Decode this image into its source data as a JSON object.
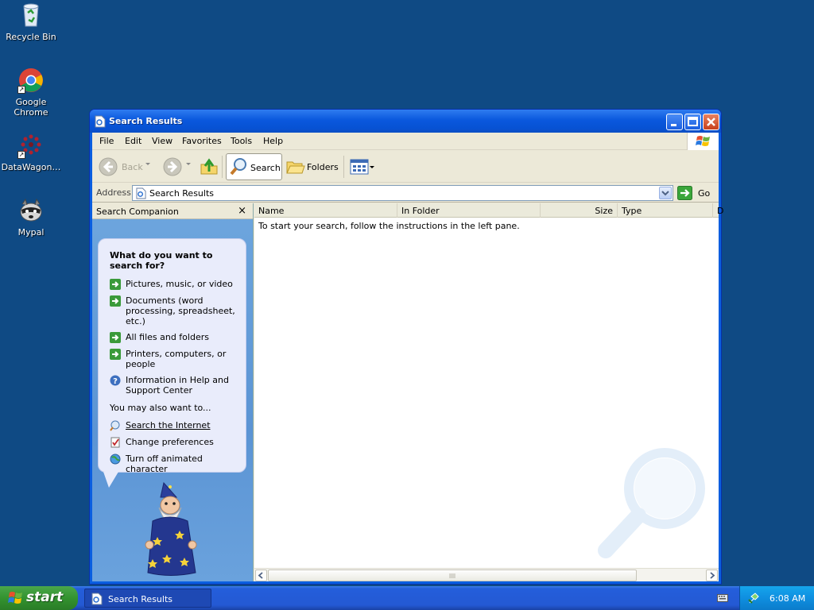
{
  "desktop": {
    "icons": [
      {
        "label": "Recycle Bin",
        "icon": "recycle-bin-icon"
      },
      {
        "label": "Google Chrome",
        "icon": "chrome-icon"
      },
      {
        "label": "DataWagon…",
        "icon": "datawagon-icon"
      },
      {
        "label": "Mypal",
        "icon": "mypal-icon"
      }
    ]
  },
  "window": {
    "title": "Search Results",
    "menu": [
      "File",
      "Edit",
      "View",
      "Favorites",
      "Tools",
      "Help"
    ],
    "toolbar": {
      "back": "Back",
      "search": "Search",
      "folders": "Folders"
    },
    "address": {
      "label": "Address",
      "value": "Search Results",
      "go": "Go"
    },
    "companion": {
      "header": "Search Companion",
      "close": "×",
      "question": "What do you want to search for?",
      "options": [
        {
          "label": "Pictures, music, or video",
          "icon": "green-arrow-icon"
        },
        {
          "label": "Documents (word processing, spreadsheet, etc.)",
          "icon": "green-arrow-icon"
        },
        {
          "label": "All files and folders",
          "icon": "green-arrow-icon"
        },
        {
          "label": "Printers, computers, or people",
          "icon": "green-arrow-icon"
        },
        {
          "label": "Information in Help and Support Center",
          "icon": "help-icon"
        }
      ],
      "also_label": "You may also want to...",
      "also_options": [
        {
          "label": "Search the Internet",
          "icon": "search-internet-icon"
        },
        {
          "label": "Change preferences",
          "icon": "preferences-icon"
        },
        {
          "label": "Turn off animated character",
          "icon": "globe-icon"
        }
      ]
    },
    "results": {
      "columns": [
        "Name",
        "In Folder",
        "Size",
        "Type",
        "D"
      ],
      "message": "To start your search, follow the instructions in the left pane."
    }
  },
  "taskbar": {
    "start": "start",
    "task": "Search Results",
    "clock": "6:08 AM"
  },
  "colors": {
    "desktop": "#0f4a84",
    "titlebar": "#0a58dd",
    "companion": "#6ea6de",
    "taskbar": "#245edb",
    "start": "#33932f"
  }
}
